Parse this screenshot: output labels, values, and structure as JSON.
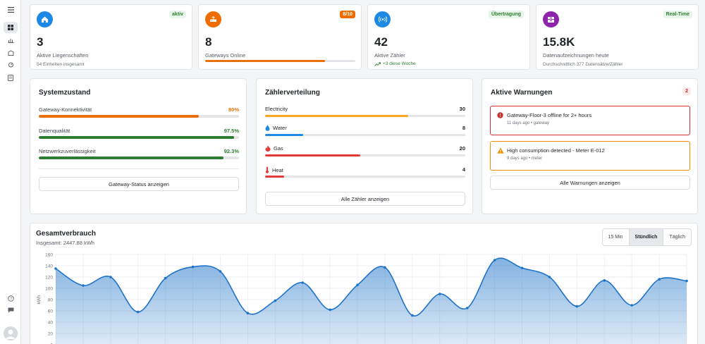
{
  "sidebar": {
    "items": [
      "menu-icon",
      "dashboard-icon",
      "analytics-icon",
      "properties-icon",
      "meters-icon",
      "reports-icon"
    ],
    "bottom": [
      "help-icon",
      "feedback-icon"
    ]
  },
  "kpis": [
    {
      "value": "3",
      "label": "Aktive Liegenschaften",
      "sub": "54 Einheiten insgesamt",
      "badge": "aktiv",
      "icon": "home-icon",
      "color": "#1e88e5"
    },
    {
      "value": "8",
      "label": "Gateways Online",
      "badge": "8/10",
      "icon": "router-icon",
      "color": "#ef6c00",
      "progress": 0.8
    },
    {
      "value": "42",
      "label": "Aktive Zähler",
      "trend": "+3 diese Woche",
      "badge": "Übertragung",
      "icon": "signal-icon",
      "color": "#1e88e5"
    },
    {
      "value": "15.8K",
      "label": "Datenaufzeichnungen heute",
      "sub": "Durchschnittlich 377 Datensätze/Zähler",
      "badge": "Real-Time",
      "icon": "database-icon",
      "color": "#8e24aa"
    }
  ],
  "system": {
    "title": "Systemzustand",
    "metrics": [
      {
        "label": "Gateway-Konnektivität",
        "value": "80%",
        "fraction": 0.8,
        "color": "#e8710a"
      },
      {
        "label": "Datenqualität",
        "value": "97.5%",
        "fraction": 0.975,
        "color": "#2e7d32"
      },
      {
        "label": "Netzwerkzuverlässigkeit",
        "value": "92.3%",
        "fraction": 0.923,
        "color": "#2e7d32"
      }
    ],
    "button": "Gateway-Status anzeigen"
  },
  "distribution": {
    "title": "Zählerverteilung",
    "items": [
      {
        "label": "Electricity",
        "count": "30",
        "fraction": 0.714,
        "color": "#f9a825",
        "icon": ""
      },
      {
        "label": "Water",
        "count": "8",
        "fraction": 0.19,
        "color": "#1e88e5",
        "icon": "water-drop-icon"
      },
      {
        "label": "Gas",
        "count": "20",
        "fraction": 0.476,
        "color": "#e53935",
        "icon": "flame-icon"
      },
      {
        "label": "Heat",
        "count": "4",
        "fraction": 0.095,
        "color": "#e53935",
        "icon": "thermometer-icon"
      }
    ],
    "button": "Alle Zähler anzeigen"
  },
  "warnings": {
    "title": "Aktive Warnungen",
    "count": "2",
    "alerts": [
      {
        "title": "Gateway-Floor-3 offline for 2+ hours",
        "meta": "11 days ago • gateway",
        "severity": "error",
        "color": "#d32f2f"
      },
      {
        "title": "High consumption detected - Meter E-012",
        "meta": "9 days ago • meter",
        "severity": "warning",
        "color": "#ef8f00"
      }
    ],
    "button": "Alle Warnungen anzeigen"
  },
  "consumption": {
    "title": "Gesamtverbrauch",
    "subtitle": "Insgesamt: 2447.88 kWh",
    "ranges": [
      "15 Min",
      "Stündlich",
      "Täglich"
    ],
    "active_range": "Stündlich"
  },
  "chart_data": {
    "type": "area",
    "title": "Gesamtverbrauch",
    "xlabel": "",
    "ylabel": "kWh",
    "ylim": [
      0,
      160
    ],
    "yticks": [
      0,
      20,
      40,
      60,
      80,
      100,
      120,
      140,
      160
    ],
    "grid": true,
    "series": [
      {
        "values": [
          135,
          105,
          120,
          58,
          118,
          138,
          130,
          56,
          78,
          110,
          62,
          106,
          137,
          52,
          90,
          65,
          150,
          136,
          120,
          68,
          114,
          70,
          116,
          113
        ]
      }
    ],
    "color": "#1e73c8"
  }
}
